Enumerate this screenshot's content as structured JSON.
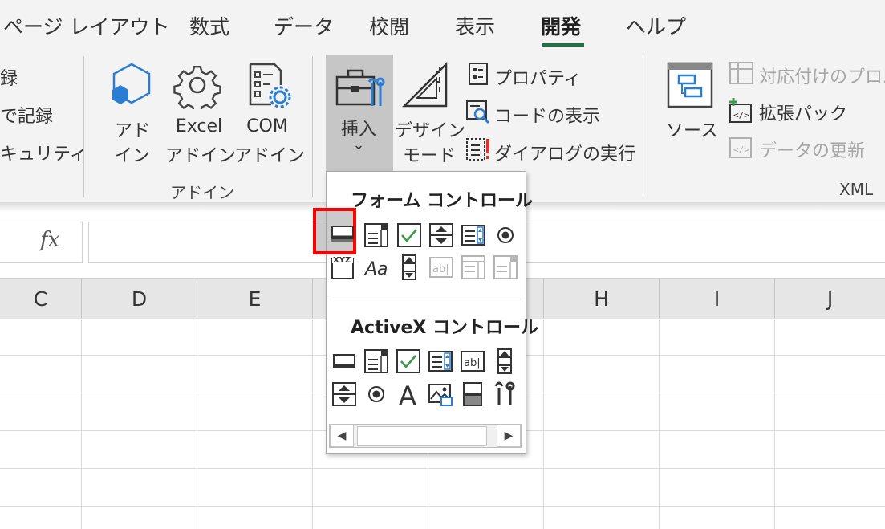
{
  "tabs": [
    {
      "label": "ページ レイアウト"
    },
    {
      "label": "数式"
    },
    {
      "label": "データ"
    },
    {
      "label": "校閲"
    },
    {
      "label": "表示"
    },
    {
      "label": "開発"
    },
    {
      "label": "ヘルプ"
    }
  ],
  "active_tab": "開発",
  "ribbon": {
    "code_group": {
      "record_macro_partial": "録",
      "relative_ref_partial": "で記録",
      "macro_security_partial": "キュリティ"
    },
    "addins_group": {
      "addins_line1": "アド",
      "addins_line2": "イン",
      "excel_addins_line1": "Excel",
      "excel_addins_line2": "アドイン",
      "com_addins_line1": "COM",
      "com_addins_line2": "アドイン",
      "group_label": "アドイン"
    },
    "controls_group": {
      "insert_label": "挿入",
      "insert_chevron": "⌄",
      "design_mode_line1": "デザイン",
      "design_mode_line2": "モード",
      "properties": "プロパティ",
      "view_code": "コードの表示",
      "run_dialog": "ダイアログの実行"
    },
    "xml_group": {
      "source": "ソース",
      "map_properties_partial": "対応付けのプロパ",
      "expansion_packs": "拡張パック",
      "refresh_data": "データの更新",
      "group_label": "XML"
    }
  },
  "formula_bar": {
    "fx_label": "fx",
    "value": ""
  },
  "columns": [
    "C",
    "D",
    "E",
    "",
    "H",
    "I",
    "J"
  ],
  "insert_dropdown": {
    "form_controls_title": "フォーム コントロール",
    "activex_controls_title": "ActiveX コントロール",
    "form_controls": [
      {
        "icon": "button-icon",
        "selected": true
      },
      {
        "icon": "combo-box-icon"
      },
      {
        "icon": "check-box-icon"
      },
      {
        "icon": "spin-button-icon"
      },
      {
        "icon": "list-box-icon"
      },
      {
        "icon": "option-button-icon"
      },
      {
        "icon": "group-box-icon",
        "text": "XYZ"
      },
      {
        "icon": "label-icon",
        "text": "Aa"
      },
      {
        "icon": "scroll-bar-icon"
      },
      {
        "icon": "text-field-icon",
        "text": "ab|",
        "disabled": true
      },
      {
        "icon": "combo-list-edit-icon",
        "disabled": true
      },
      {
        "icon": "combo-drop-down-edit-icon",
        "disabled": true
      }
    ],
    "activex_controls": [
      {
        "icon": "command-button-icon"
      },
      {
        "icon": "combo-box-icon"
      },
      {
        "icon": "check-box-icon"
      },
      {
        "icon": "list-box-icon"
      },
      {
        "icon": "text-box-icon",
        "text": "ab|"
      },
      {
        "icon": "scroll-bar-icon"
      },
      {
        "icon": "spin-button-icon"
      },
      {
        "icon": "option-button-icon"
      },
      {
        "icon": "label-icon",
        "text": "A"
      },
      {
        "icon": "image-icon"
      },
      {
        "icon": "toggle-button-icon"
      },
      {
        "icon": "more-controls-icon"
      }
    ]
  },
  "colors": {
    "accent": "#217346",
    "selection_highlight": "#ff0000",
    "icon_blue": "#2b7cd3",
    "check_green": "#3a9a47"
  }
}
